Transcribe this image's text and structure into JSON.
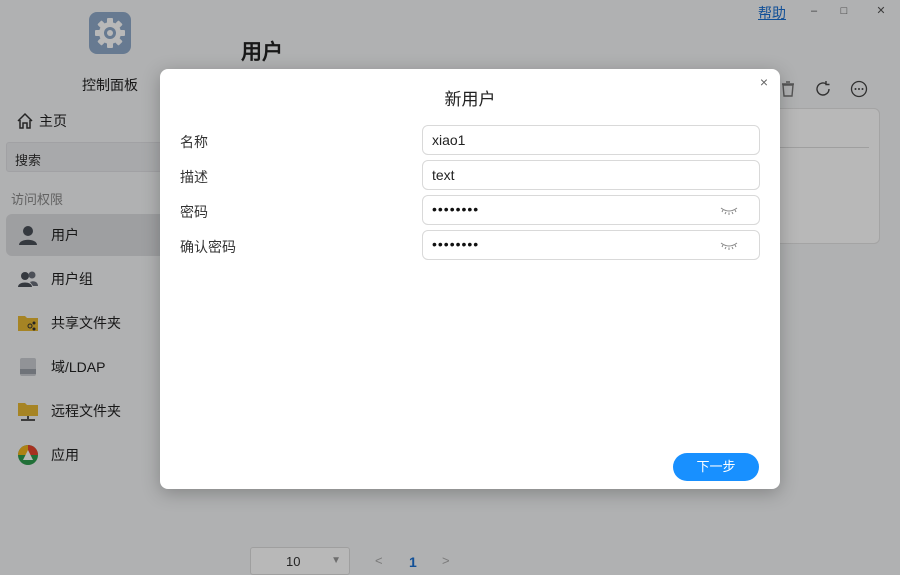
{
  "window": {
    "help_label": "帮助",
    "minimize": "–",
    "maximize": "□",
    "close": "✕"
  },
  "sidebar": {
    "app_title": "控制面板",
    "home_label": "主页",
    "search_placeholder": "搜索",
    "section_label": "访问权限",
    "items": [
      {
        "label": "用户",
        "icon": "user-icon"
      },
      {
        "label": "用户组",
        "icon": "user-group-icon"
      },
      {
        "label": "共享文件夹",
        "icon": "shared-folder-icon"
      },
      {
        "label": "域/LDAP",
        "icon": "ldap-icon"
      },
      {
        "label": "远程文件夹",
        "icon": "remote-folder-icon"
      },
      {
        "label": "应用",
        "icon": "app-icon"
      }
    ]
  },
  "main": {
    "title": "用户",
    "pager": {
      "page_size": "10",
      "prev": "<",
      "current": "1",
      "next": ">"
    }
  },
  "dialog": {
    "title": "新用户",
    "close": "×",
    "fields": [
      {
        "label": "名称",
        "value": "xiao1"
      },
      {
        "label": "描述",
        "value": "text"
      },
      {
        "label": "密码",
        "value": "••••••••"
      },
      {
        "label": "确认密码",
        "value": "••••••••"
      }
    ],
    "next_label": "下一步"
  },
  "colors": {
    "accent": "#1890ff",
    "link": "#1a6fd1"
  }
}
